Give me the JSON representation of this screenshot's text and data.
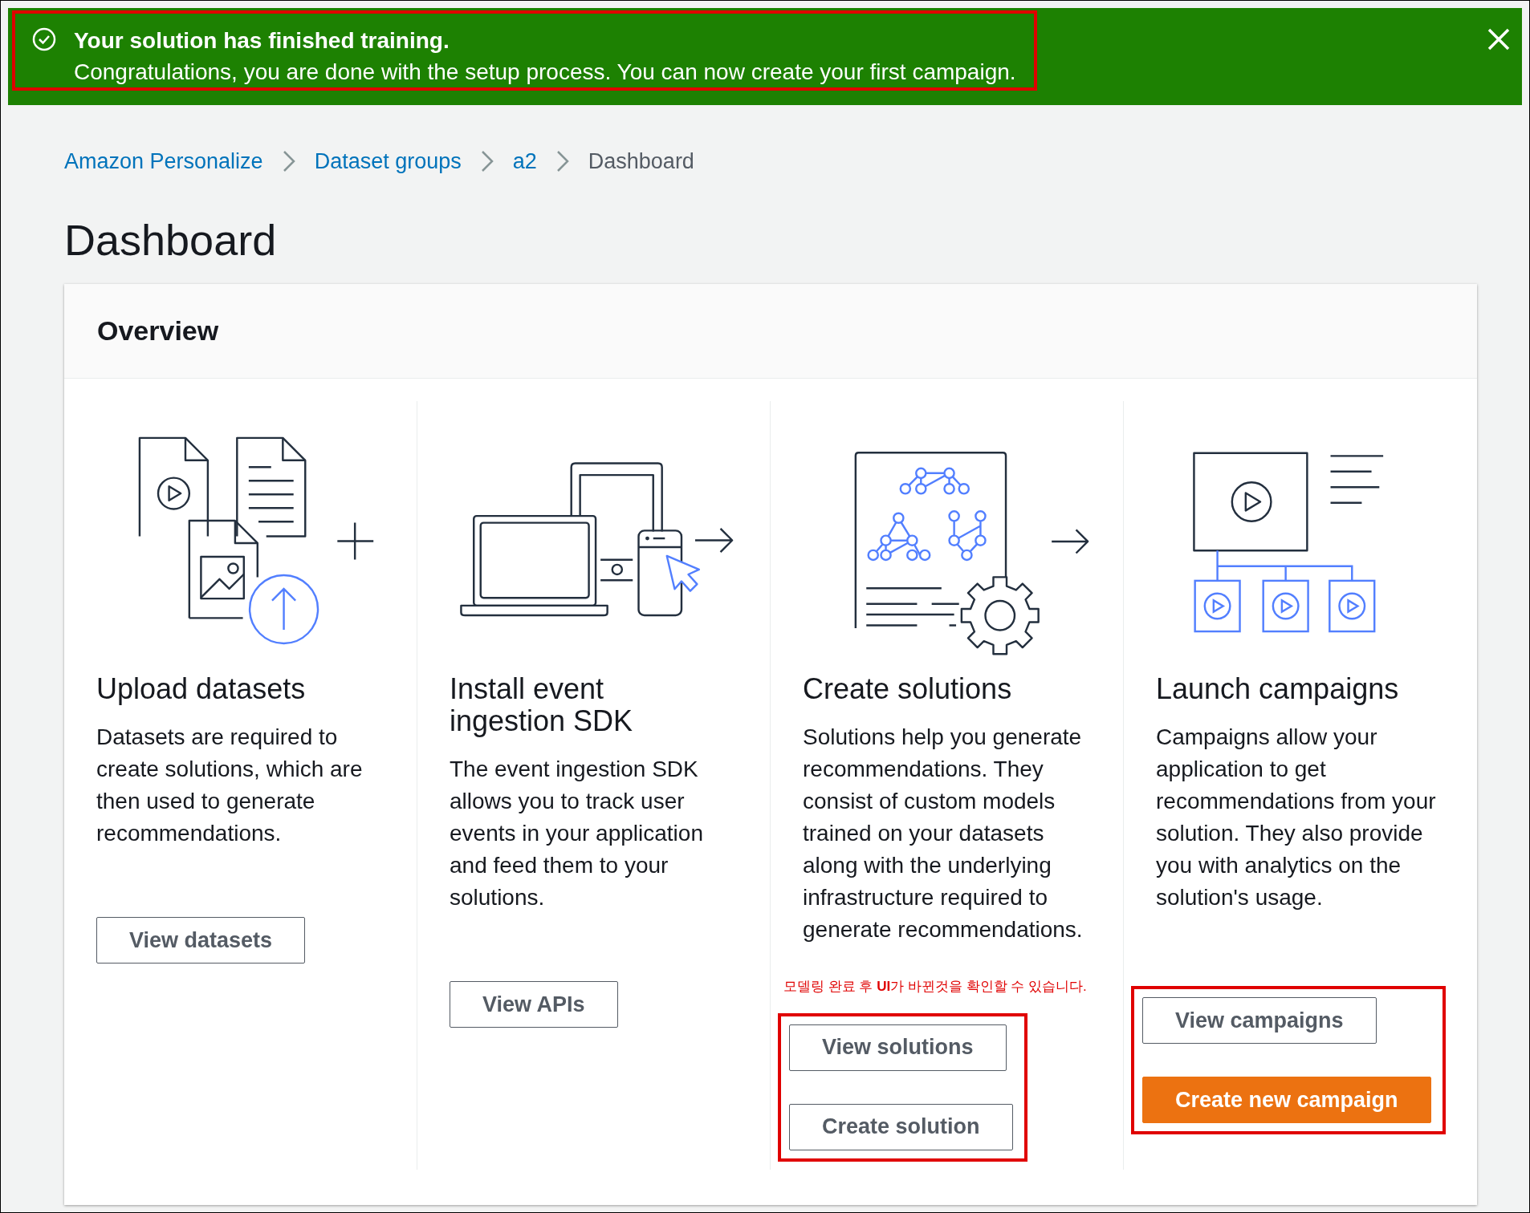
{
  "notification": {
    "title": "Your solution has finished training.",
    "message": "Congratulations, you are done with the setup process. You can now create your first campaign.",
    "highlighted": true
  },
  "breadcrumbs": [
    {
      "label": "Amazon Personalize",
      "current": false
    },
    {
      "label": "Dataset groups",
      "current": false
    },
    {
      "label": "a2",
      "current": false
    },
    {
      "label": "Dashboard",
      "current": true
    }
  ],
  "page_title": "Dashboard",
  "overview": {
    "title": "Overview",
    "steps": [
      {
        "kind": "datasets",
        "title": "Upload datasets",
        "description": "Datasets are required to create solutions, which are then used to generate recommendations.",
        "highlighted": false,
        "buttons": [
          {
            "label": "View datasets",
            "kind": "normal"
          }
        ]
      },
      {
        "kind": "events",
        "title": "Install event ingestion SDK",
        "description": "The event ingestion SDK allows you to track user events in your application and feed them to your solutions.",
        "highlighted": false,
        "buttons": [
          {
            "label": "View APIs",
            "kind": "normal"
          }
        ]
      },
      {
        "kind": "solutions",
        "title": "Create solutions",
        "description": "Solutions help you generate recommendations. They consist of custom models trained on your datasets along with the underlying infrastructure required to generate recommendations.",
        "note": "모델링 완료 후 **UI**가 바뀐것을 확인할 수 있습니다.",
        "highlighted": true,
        "buttons": [
          {
            "label": "View solutions",
            "kind": "normal"
          },
          {
            "label": "Create solution",
            "kind": "normal"
          }
        ]
      },
      {
        "kind": "campaigns",
        "title": "Launch campaigns",
        "description": "Campaigns allow your application to get recommendations from your solution. They also provide you with analytics on the solution's usage.",
        "highlighted": true,
        "buttons": [
          {
            "label": "View campaigns",
            "kind": "normal"
          },
          {
            "label": "Create new campaign",
            "kind": "primary"
          }
        ]
      }
    ]
  }
}
